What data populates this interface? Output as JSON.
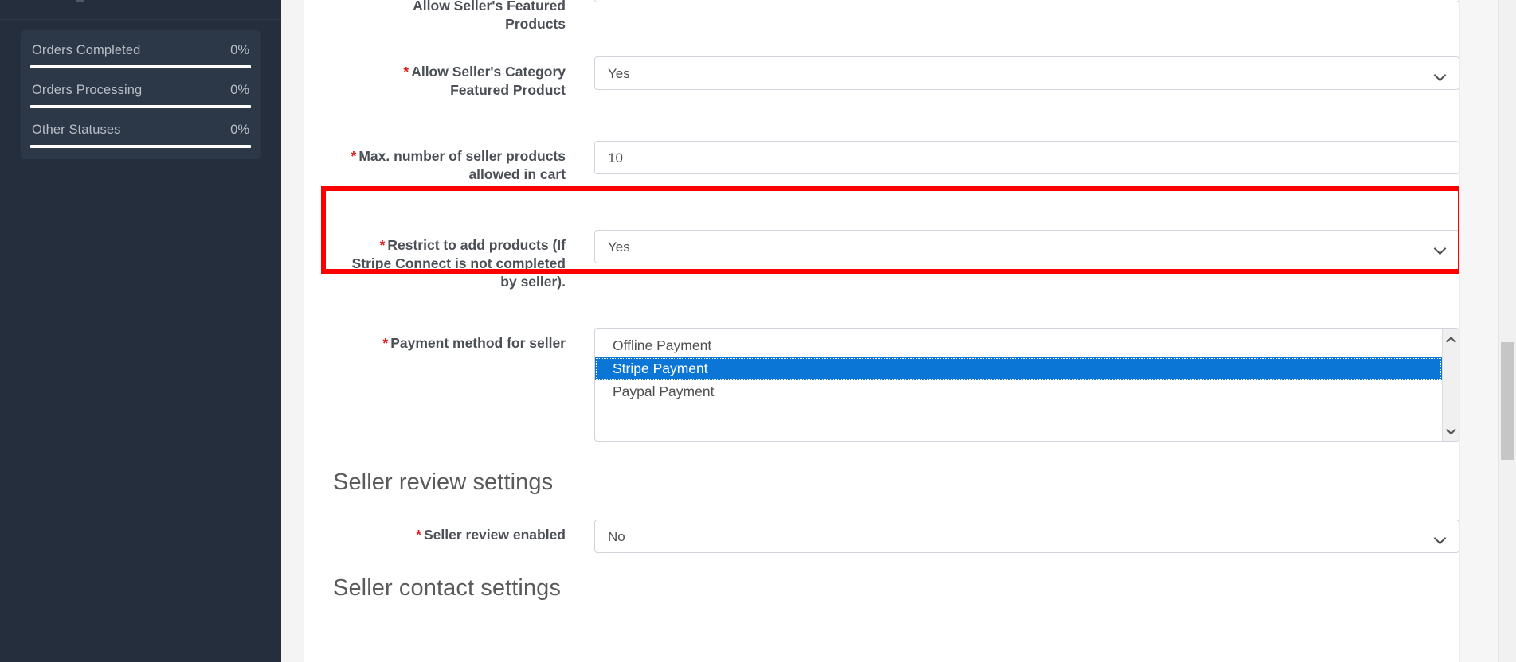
{
  "sidebar": {
    "stats_card": {
      "rows": [
        {
          "label": "Orders Completed",
          "percent": "0%",
          "value": 0
        },
        {
          "label": "Orders Processing",
          "percent": "0%",
          "value": 0
        },
        {
          "label": "Other Statuses",
          "percent": "0%",
          "value": 0
        }
      ]
    }
  },
  "main": {
    "fields": [
      {
        "label_lines": [
          "Allow Seller's Featured",
          "Products"
        ],
        "required": true,
        "type": "select",
        "value": "",
        "clipped": true
      },
      {
        "label_lines": [
          "Allow Seller's Category",
          "Featured Product"
        ],
        "required": true,
        "type": "select",
        "value": "Yes"
      },
      {
        "label_lines": [
          "Max. number of seller products",
          "allowed in cart"
        ],
        "required": true,
        "type": "text",
        "value": "10"
      },
      {
        "label_lines": [
          "Restrict to add products (If",
          "Stripe Connect is not completed",
          "by seller)."
        ],
        "required": true,
        "type": "select",
        "value": "Yes",
        "highlighted": true
      },
      {
        "label_lines": [
          "Payment method for seller"
        ],
        "required": true,
        "type": "listbox",
        "options": [
          {
            "label": "Offline Payment",
            "selected": false
          },
          {
            "label": "Stripe Payment",
            "selected": true
          },
          {
            "label": "Paypal Payment",
            "selected": false
          }
        ]
      }
    ],
    "sections": [
      {
        "heading": "Seller review settings"
      },
      {
        "heading": "Seller contact settings"
      }
    ],
    "review_field": {
      "label_lines": [
        "Seller review enabled"
      ],
      "required": true,
      "type": "select",
      "value": "No"
    }
  },
  "colors": {
    "sidebar_bg": "#242e3c",
    "card_bg": "#2c3747",
    "highlight_border": "#ff0000",
    "selection_blue": "#0c76d6",
    "required_red": "#e41b1b"
  },
  "icons": {
    "chevron_down": "chevron-down-icon",
    "chevron_up": "chevron-up-icon"
  }
}
